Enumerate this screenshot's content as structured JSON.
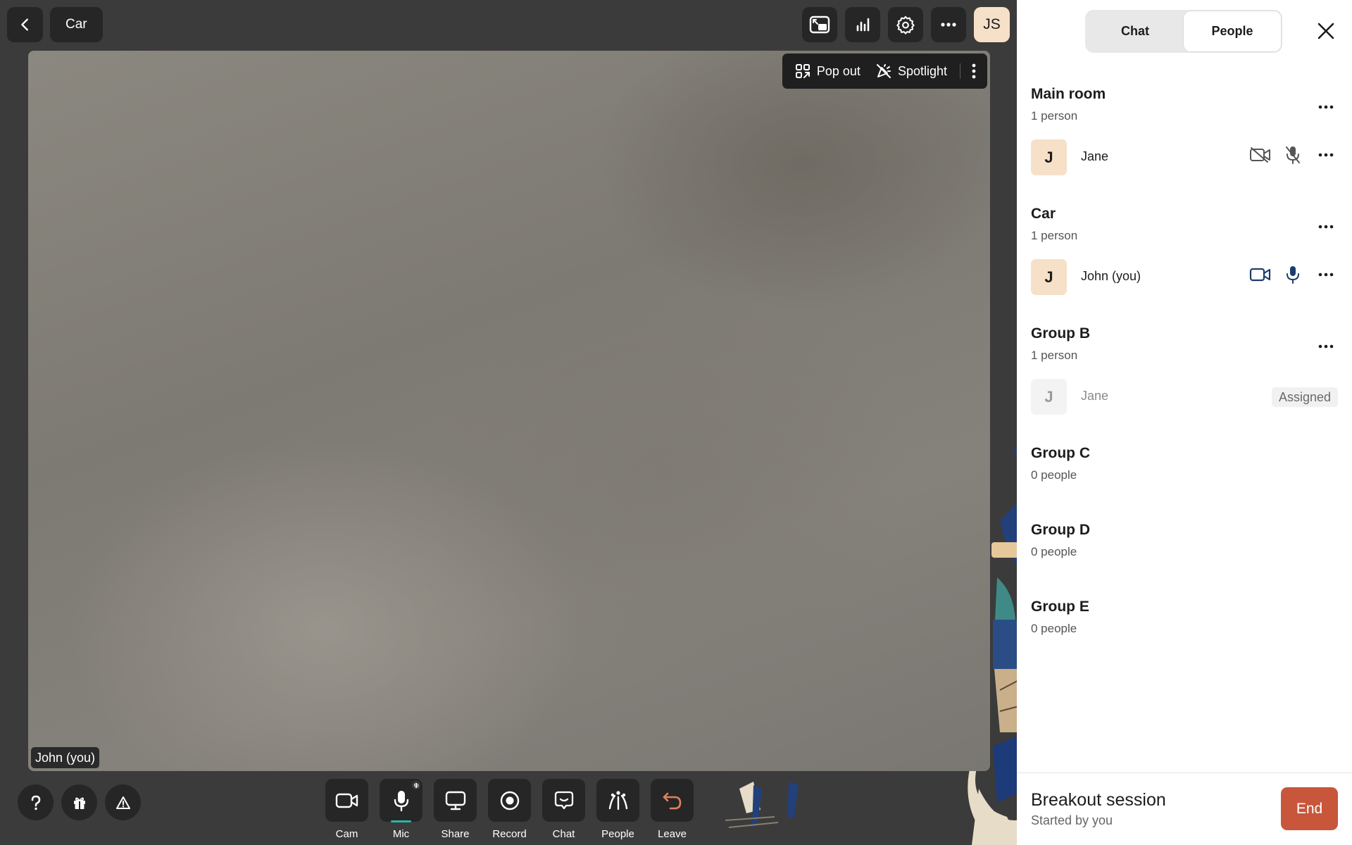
{
  "header": {
    "room_name": "Car",
    "avatar_initials": "JS",
    "tools": [
      "picture-in-picture-icon",
      "stats-icon",
      "gear-icon",
      "more-icon"
    ]
  },
  "video": {
    "pop_out_label": "Pop out",
    "spotlight_label": "Spotlight",
    "name_tag": "John (you)"
  },
  "controls": [
    {
      "label": "Cam",
      "icon": "camera-icon"
    },
    {
      "label": "Mic",
      "icon": "microphone-icon"
    },
    {
      "label": "Share",
      "icon": "screen-share-icon"
    },
    {
      "label": "Record",
      "icon": "record-icon"
    },
    {
      "label": "Chat",
      "icon": "chat-icon"
    },
    {
      "label": "People",
      "icon": "people-icon"
    },
    {
      "label": "Leave",
      "icon": "leave-icon"
    }
  ],
  "panel": {
    "tabs": [
      "Chat",
      "People"
    ],
    "active_tab": "People",
    "rooms": [
      {
        "name": "Main room",
        "count": "1 person",
        "people": [
          {
            "initial": "J",
            "name": "Jane"
          }
        ]
      },
      {
        "name": "Car",
        "count": "1 person",
        "people": [
          {
            "initial": "J",
            "name": "John (you)"
          }
        ]
      },
      {
        "name": "Group B",
        "count": "1 person",
        "people": [
          {
            "initial": "J",
            "name": "Jane",
            "badge": "Assigned"
          }
        ]
      },
      {
        "name": "Group C",
        "count": "0 people"
      },
      {
        "name": "Group D",
        "count": "0 people"
      },
      {
        "name": "Group E",
        "count": "0 people"
      }
    ],
    "footer": {
      "title": "Breakout session",
      "subtitle": "Started by you",
      "end_label": "End"
    }
  },
  "colors": {
    "accent_end": "#c8563b",
    "mic_active": "#2ab5a3",
    "avatar_bg": "#f6e0c8"
  }
}
